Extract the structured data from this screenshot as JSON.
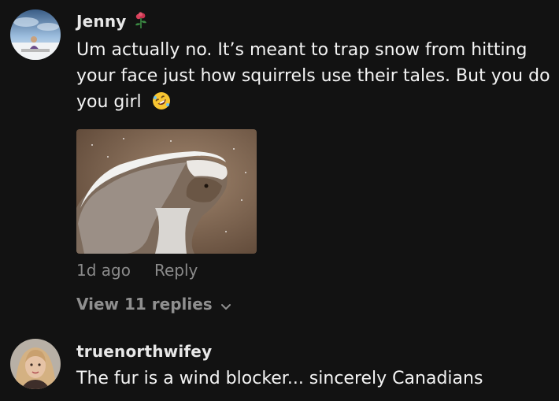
{
  "comments": [
    {
      "username": "Jenny",
      "username_icon": "rose-icon",
      "text": "Um actually no. It’s meant to trap snow from hitting your face just how squirrels use their tales. But you do you girl",
      "emoji": "rolling-on-floor-laughing-emoji",
      "attachment": "squirrel-in-snow-photo",
      "time": "1d ago",
      "reply_label": "Reply",
      "view_replies_label": "View 11 replies"
    },
    {
      "username": "truenorthwifey",
      "text": "The fur is a wind blocker... sincerely Canadians"
    }
  ]
}
